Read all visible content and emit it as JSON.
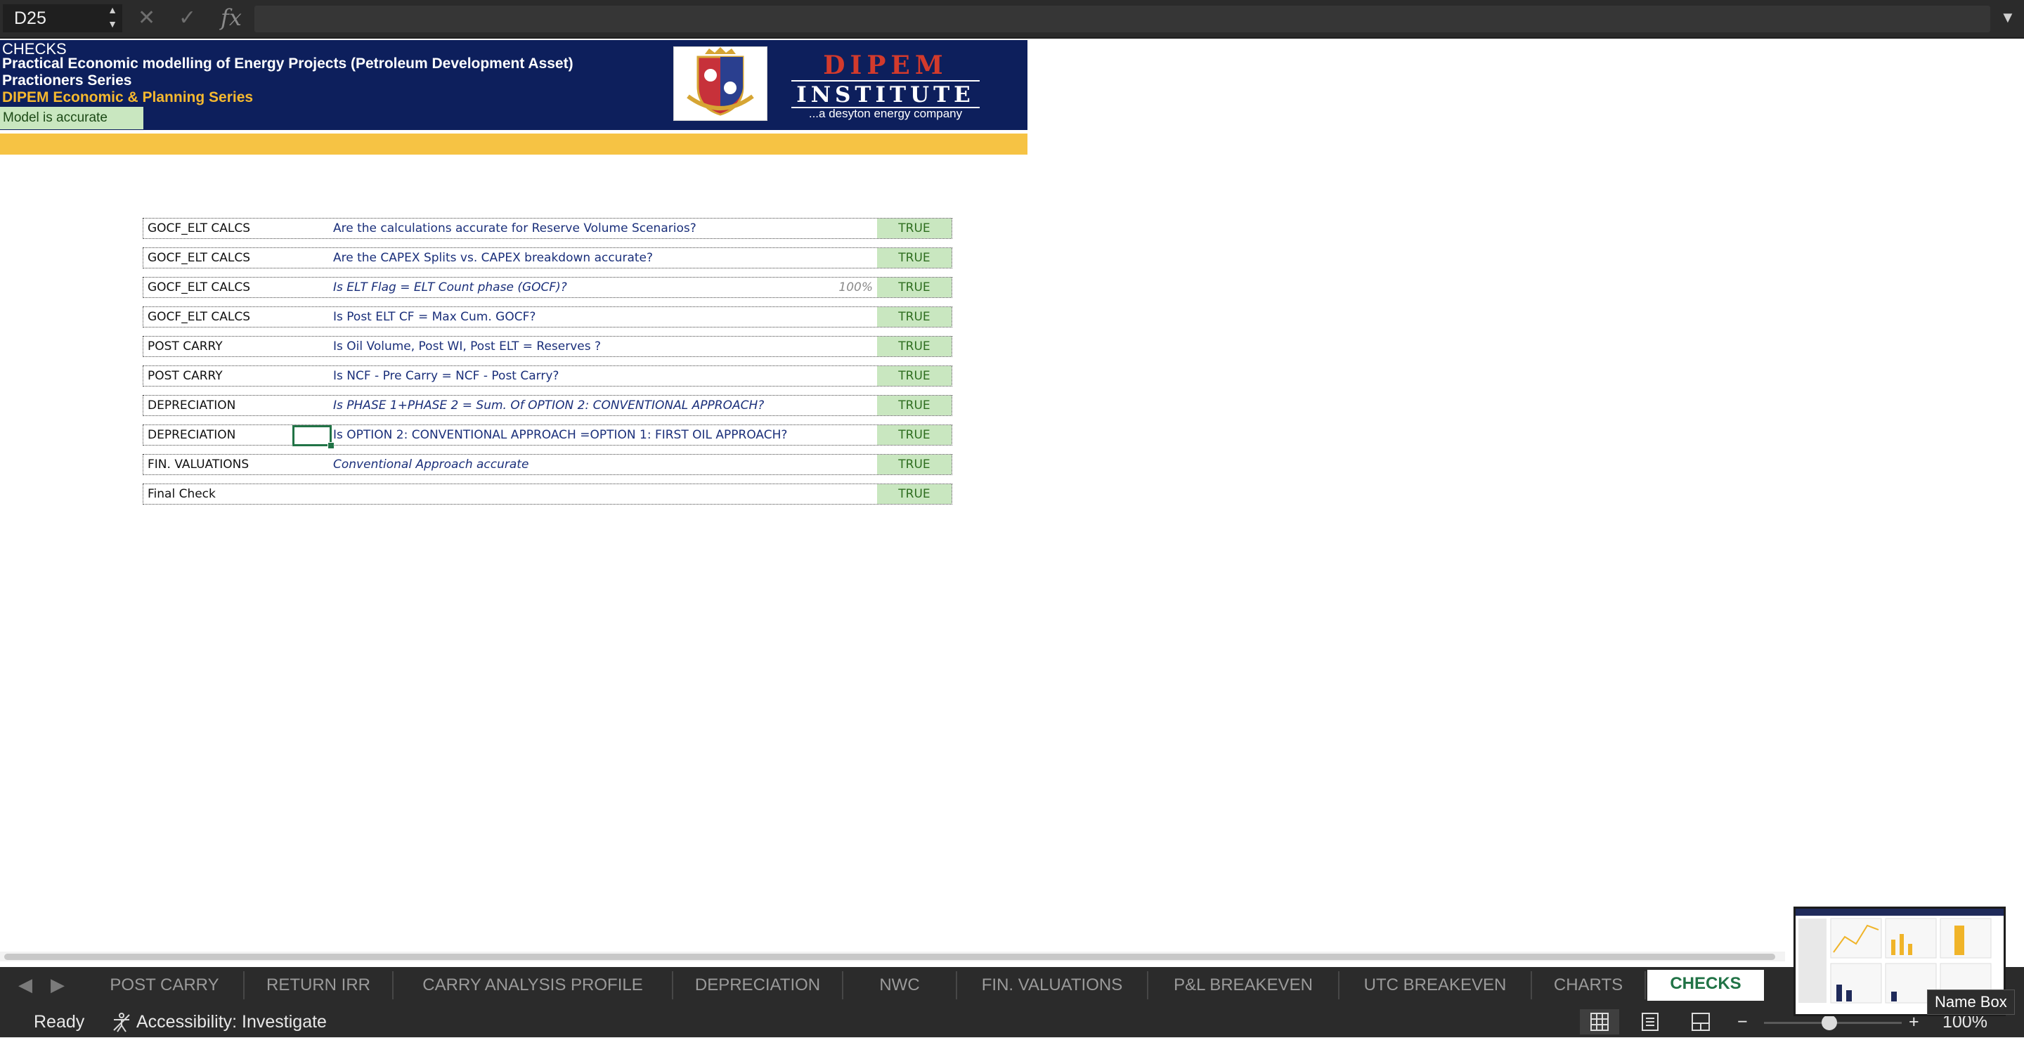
{
  "formula_bar": {
    "name_box": "D25",
    "spin_up": "▲",
    "spin_down": "▼",
    "cancel_glyph": "✕",
    "enter_glyph": "✓",
    "fx_label": "fx",
    "formula_value": "",
    "expand_glyph": "▼"
  },
  "header": {
    "line1": "CHECKS",
    "line2": "Practical Economic modelling of Energy Projects (Petroleum Development Asset)",
    "line3": "Practioners Series",
    "line4": "DIPEM Economic & Planning Series",
    "status": "Model is accurate",
    "brand": {
      "name": "DIPEM",
      "institute": "INSTITUTE",
      "tagline": "...a desyton energy company"
    }
  },
  "checks": [
    {
      "sheet": "GOCF_ELT CALCS",
      "question": "Are the  calculations accurate for Reserve Volume Scenarios?",
      "italic": false,
      "pct": "",
      "result": "TRUE"
    },
    {
      "sheet": "GOCF_ELT CALCS",
      "question": "Are the CAPEX Splits vs. CAPEX breakdown accurate?",
      "italic": false,
      "pct": "",
      "result": "TRUE"
    },
    {
      "sheet": "GOCF_ELT CALCS",
      "question": "Is ELT Flag = ELT Count phase (GOCF)?",
      "italic": true,
      "pct": "100%",
      "result": "TRUE"
    },
    {
      "sheet": "GOCF_ELT CALCS",
      "question": "Is Post ELT CF = Max Cum. GOCF?",
      "italic": false,
      "pct": "",
      "result": "TRUE"
    },
    {
      "sheet": "POST CARRY",
      "question": "Is Oil Volume, Post WI, Post ELT = Reserves ?",
      "italic": false,
      "pct": "",
      "result": "TRUE"
    },
    {
      "sheet": "POST CARRY",
      "question": "Is NCF - Pre Carry = NCF - Post Carry?",
      "italic": false,
      "pct": "",
      "result": "TRUE"
    },
    {
      "sheet": "DEPRECIATION",
      "question": "Is PHASE 1+PHASE 2 = Sum. Of  OPTION 2: CONVENTIONAL APPROACH?",
      "italic": true,
      "pct": "",
      "result": "TRUE"
    },
    {
      "sheet": "DEPRECIATION",
      "question": "Is OPTION 2: CONVENTIONAL APPROACH =OPTION 1: FIRST OIL APPROACH?",
      "italic": false,
      "pct": "",
      "result": "TRUE"
    },
    {
      "sheet": "FIN. VALUATIONS",
      "question": "Conventional Approach accurate",
      "italic": true,
      "pct": "",
      "result": "TRUE"
    },
    {
      "sheet": "Final Check",
      "question": "",
      "italic": false,
      "pct": "",
      "result": "TRUE"
    }
  ],
  "tabs": [
    {
      "label": "POST CARRY",
      "active": false
    },
    {
      "label": "RETURN IRR",
      "active": false
    },
    {
      "label": "CARRY ANALYSIS PROFILE",
      "active": false
    },
    {
      "label": "DEPRECIATION",
      "active": false
    },
    {
      "label": "NWC",
      "active": false
    },
    {
      "label": "FIN. VALUATIONS",
      "active": false
    },
    {
      "label": "P&L BREAKEVEN",
      "active": false
    },
    {
      "label": "UTC BREAKEVEN",
      "active": false
    },
    {
      "label": "CHARTS",
      "active": false
    },
    {
      "label": "CHECKS",
      "active": true
    }
  ],
  "tab_nav": {
    "prev": "◀",
    "next": "▶"
  },
  "status_bar": {
    "ready": "Ready",
    "accessibility": "Accessibility: Investigate",
    "zoom_minus": "−",
    "zoom_plus": "+",
    "zoom_level": "100%"
  },
  "tooltip": "Name Box",
  "colors": {
    "banner": "#0d1f5c",
    "accent_yellow": "#f6b92f",
    "true_fill": "#c9e7c0",
    "true_text": "#2e6e1f",
    "excel_green": "#217346"
  }
}
